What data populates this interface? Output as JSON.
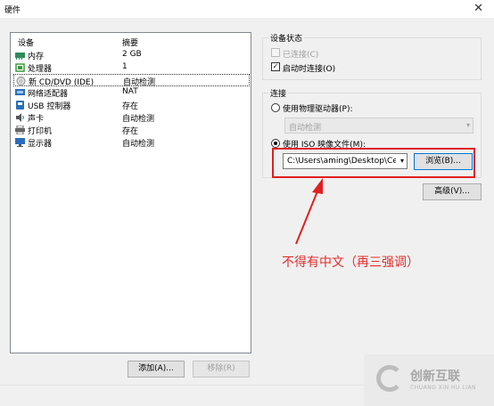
{
  "window": {
    "title": "硬件",
    "close_symbol": "✕"
  },
  "device_list": {
    "columns": {
      "device": "设备",
      "summary": "摘要"
    },
    "rows": [
      {
        "name": "内存",
        "summary": "2 GB",
        "icon": "memory-icon",
        "color": "#2e8b57"
      },
      {
        "name": "处理器",
        "summary": "1",
        "icon": "processor-icon",
        "color": "#3a9a3a"
      },
      {
        "name": "新 CD/DVD (IDE)",
        "summary": "自动检测",
        "icon": "cd-dvd-icon",
        "color": "#8a8a8a"
      },
      {
        "name": "网络适配器",
        "summary": "NAT",
        "icon": "network-adapter-icon",
        "color": "#2a6ebb"
      },
      {
        "name": "USB 控制器",
        "summary": "存在",
        "icon": "usb-icon",
        "color": "#2a6ebb"
      },
      {
        "name": "声卡",
        "summary": "自动检测",
        "icon": "sound-card-icon",
        "color": "#555555"
      },
      {
        "name": "打印机",
        "summary": "存在",
        "icon": "printer-icon",
        "color": "#666666"
      },
      {
        "name": "显示器",
        "summary": "自动检测",
        "icon": "display-icon",
        "color": "#2a6ebb"
      }
    ],
    "selected_index": 2
  },
  "buttons": {
    "add": "添加(A)...",
    "remove": "移除(R)",
    "browse": "浏览(B)...",
    "advanced": "高级(V)..."
  },
  "device_status": {
    "label": "设备状态",
    "connected": {
      "label": "已连接(C)",
      "checked": false,
      "enabled": false
    },
    "connect_at_power_on": {
      "label": "启动时连接(O)",
      "checked": true,
      "enabled": true
    }
  },
  "connection": {
    "label": "连接",
    "physical_drive": {
      "label": "使用物理驱动器(P):",
      "selected": false
    },
    "physical_drive_value": "自动检测",
    "iso_image": {
      "label": "使用 ISO 映像文件(M):",
      "selected": true
    },
    "iso_path": "C:\\Users\\aming\\Desktop\\Cer"
  },
  "annotation": {
    "text": "不得有中文（再三强调）",
    "color": "#e52b2b"
  },
  "watermark": {
    "brand": "创新互联",
    "sub": "CHUANG XIN HU LIAN"
  }
}
